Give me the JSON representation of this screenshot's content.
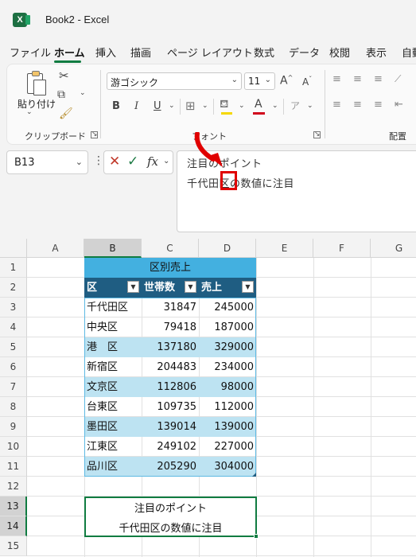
{
  "window": {
    "title": "Book2  -  Excel"
  },
  "menu": [
    "ファイル",
    "ホーム",
    "挿入",
    "描画",
    "ページ レイアウト",
    "数式",
    "データ",
    "校閲",
    "表示",
    "自動"
  ],
  "ribbon": {
    "paste_label": "貼り付け",
    "font_name": "游ゴシック",
    "font_size": "11",
    "bold": "B",
    "italic": "I",
    "underline": "U",
    "font_color_letter": "A",
    "grow_font": "A",
    "shrink_font": "A",
    "groups": {
      "clipboard": "クリップボード",
      "font": "フォント",
      "alignment": "配置"
    }
  },
  "formula_bar": {
    "name_box": "B13",
    "fx": "fx",
    "line1": "注目のポイント",
    "line2": "千代田区の数値に注目"
  },
  "grid": {
    "columns": [
      "A",
      "B",
      "C",
      "D",
      "E",
      "F",
      "G"
    ],
    "rows": [
      "1",
      "2",
      "3",
      "4",
      "5",
      "6",
      "7",
      "8",
      "9",
      "10",
      "11",
      "12",
      "13",
      "14",
      "15"
    ]
  },
  "table": {
    "title": "区別売上",
    "headers": [
      "区",
      "世帯数",
      "売上"
    ],
    "rows": [
      [
        "千代田区",
        "31847",
        "245000"
      ],
      [
        "中央区",
        "79418",
        "187000"
      ],
      [
        "港　区",
        "137180",
        "329000"
      ],
      [
        "新宿区",
        "204483",
        "234000"
      ],
      [
        "文京区",
        "112806",
        "98000"
      ],
      [
        "台東区",
        "109735",
        "112000"
      ],
      [
        "墨田区",
        "139014",
        "139000"
      ],
      [
        "江東区",
        "249102",
        "227000"
      ],
      [
        "品川区",
        "205290",
        "304000"
      ]
    ]
  },
  "note": {
    "line1": "注目のポイント",
    "line2": "千代田区の数値に注目"
  },
  "colors": {
    "accent": "#107c41",
    "table_header": "#1f5d82",
    "table_title": "#43b0e0",
    "band": "#bde3f2",
    "highlight": "#e00000"
  }
}
